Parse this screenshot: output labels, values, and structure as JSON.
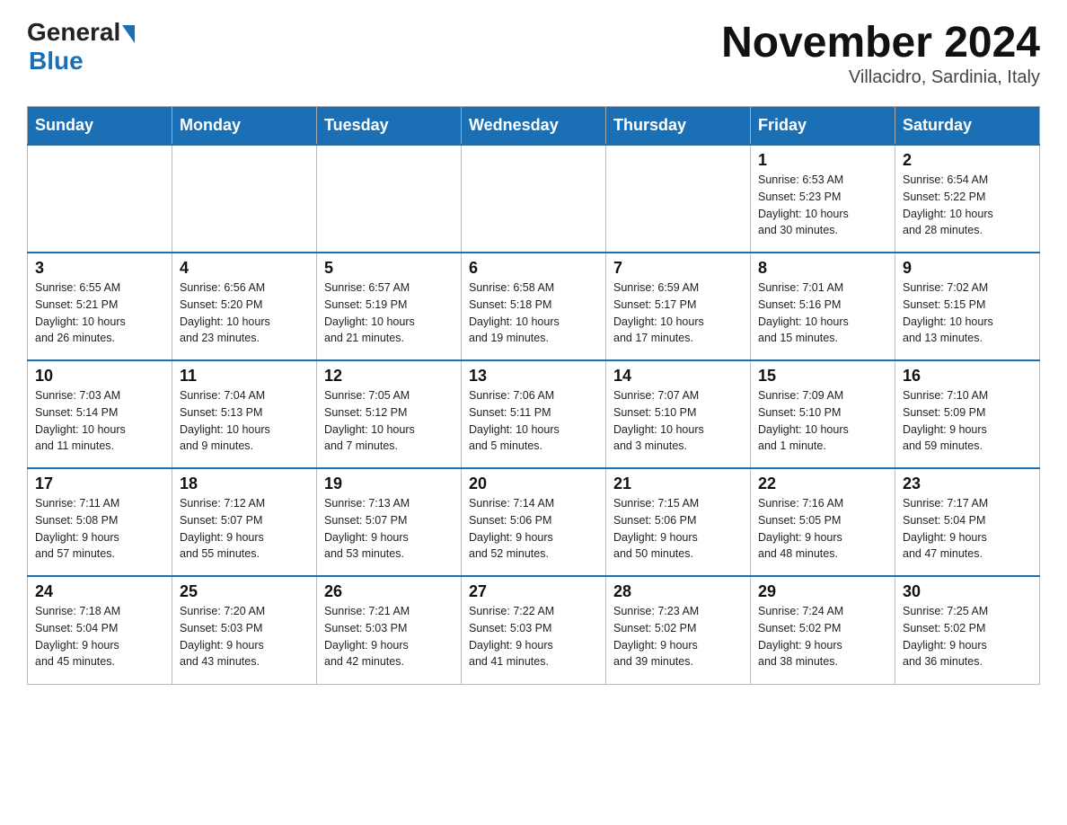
{
  "header": {
    "logo_general": "General",
    "logo_blue": "Blue",
    "month_year": "November 2024",
    "location": "Villacidro, Sardinia, Italy"
  },
  "weekdays": [
    "Sunday",
    "Monday",
    "Tuesday",
    "Wednesday",
    "Thursday",
    "Friday",
    "Saturday"
  ],
  "weeks": [
    [
      {
        "day": "",
        "info": ""
      },
      {
        "day": "",
        "info": ""
      },
      {
        "day": "",
        "info": ""
      },
      {
        "day": "",
        "info": ""
      },
      {
        "day": "",
        "info": ""
      },
      {
        "day": "1",
        "info": "Sunrise: 6:53 AM\nSunset: 5:23 PM\nDaylight: 10 hours\nand 30 minutes."
      },
      {
        "day": "2",
        "info": "Sunrise: 6:54 AM\nSunset: 5:22 PM\nDaylight: 10 hours\nand 28 minutes."
      }
    ],
    [
      {
        "day": "3",
        "info": "Sunrise: 6:55 AM\nSunset: 5:21 PM\nDaylight: 10 hours\nand 26 minutes."
      },
      {
        "day": "4",
        "info": "Sunrise: 6:56 AM\nSunset: 5:20 PM\nDaylight: 10 hours\nand 23 minutes."
      },
      {
        "day": "5",
        "info": "Sunrise: 6:57 AM\nSunset: 5:19 PM\nDaylight: 10 hours\nand 21 minutes."
      },
      {
        "day": "6",
        "info": "Sunrise: 6:58 AM\nSunset: 5:18 PM\nDaylight: 10 hours\nand 19 minutes."
      },
      {
        "day": "7",
        "info": "Sunrise: 6:59 AM\nSunset: 5:17 PM\nDaylight: 10 hours\nand 17 minutes."
      },
      {
        "day": "8",
        "info": "Sunrise: 7:01 AM\nSunset: 5:16 PM\nDaylight: 10 hours\nand 15 minutes."
      },
      {
        "day": "9",
        "info": "Sunrise: 7:02 AM\nSunset: 5:15 PM\nDaylight: 10 hours\nand 13 minutes."
      }
    ],
    [
      {
        "day": "10",
        "info": "Sunrise: 7:03 AM\nSunset: 5:14 PM\nDaylight: 10 hours\nand 11 minutes."
      },
      {
        "day": "11",
        "info": "Sunrise: 7:04 AM\nSunset: 5:13 PM\nDaylight: 10 hours\nand 9 minutes."
      },
      {
        "day": "12",
        "info": "Sunrise: 7:05 AM\nSunset: 5:12 PM\nDaylight: 10 hours\nand 7 minutes."
      },
      {
        "day": "13",
        "info": "Sunrise: 7:06 AM\nSunset: 5:11 PM\nDaylight: 10 hours\nand 5 minutes."
      },
      {
        "day": "14",
        "info": "Sunrise: 7:07 AM\nSunset: 5:10 PM\nDaylight: 10 hours\nand 3 minutes."
      },
      {
        "day": "15",
        "info": "Sunrise: 7:09 AM\nSunset: 5:10 PM\nDaylight: 10 hours\nand 1 minute."
      },
      {
        "day": "16",
        "info": "Sunrise: 7:10 AM\nSunset: 5:09 PM\nDaylight: 9 hours\nand 59 minutes."
      }
    ],
    [
      {
        "day": "17",
        "info": "Sunrise: 7:11 AM\nSunset: 5:08 PM\nDaylight: 9 hours\nand 57 minutes."
      },
      {
        "day": "18",
        "info": "Sunrise: 7:12 AM\nSunset: 5:07 PM\nDaylight: 9 hours\nand 55 minutes."
      },
      {
        "day": "19",
        "info": "Sunrise: 7:13 AM\nSunset: 5:07 PM\nDaylight: 9 hours\nand 53 minutes."
      },
      {
        "day": "20",
        "info": "Sunrise: 7:14 AM\nSunset: 5:06 PM\nDaylight: 9 hours\nand 52 minutes."
      },
      {
        "day": "21",
        "info": "Sunrise: 7:15 AM\nSunset: 5:06 PM\nDaylight: 9 hours\nand 50 minutes."
      },
      {
        "day": "22",
        "info": "Sunrise: 7:16 AM\nSunset: 5:05 PM\nDaylight: 9 hours\nand 48 minutes."
      },
      {
        "day": "23",
        "info": "Sunrise: 7:17 AM\nSunset: 5:04 PM\nDaylight: 9 hours\nand 47 minutes."
      }
    ],
    [
      {
        "day": "24",
        "info": "Sunrise: 7:18 AM\nSunset: 5:04 PM\nDaylight: 9 hours\nand 45 minutes."
      },
      {
        "day": "25",
        "info": "Sunrise: 7:20 AM\nSunset: 5:03 PM\nDaylight: 9 hours\nand 43 minutes."
      },
      {
        "day": "26",
        "info": "Sunrise: 7:21 AM\nSunset: 5:03 PM\nDaylight: 9 hours\nand 42 minutes."
      },
      {
        "day": "27",
        "info": "Sunrise: 7:22 AM\nSunset: 5:03 PM\nDaylight: 9 hours\nand 41 minutes."
      },
      {
        "day": "28",
        "info": "Sunrise: 7:23 AM\nSunset: 5:02 PM\nDaylight: 9 hours\nand 39 minutes."
      },
      {
        "day": "29",
        "info": "Sunrise: 7:24 AM\nSunset: 5:02 PM\nDaylight: 9 hours\nand 38 minutes."
      },
      {
        "day": "30",
        "info": "Sunrise: 7:25 AM\nSunset: 5:02 PM\nDaylight: 9 hours\nand 36 minutes."
      }
    ]
  ]
}
